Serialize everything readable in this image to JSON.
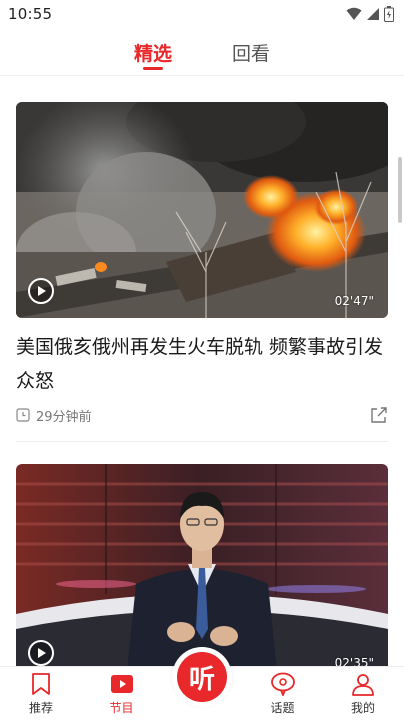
{
  "status_bar": {
    "time": "10:55"
  },
  "top_tabs": [
    {
      "label": "精选",
      "active": true
    },
    {
      "label": "回看",
      "active": false
    }
  ],
  "feed": [
    {
      "title": "美国俄亥俄州再发生火车脱轨 频繁事故引发众怒",
      "time_ago": "29分钟前",
      "duration": "02'47\"",
      "thumbnail": "train-derailment-fire-smoke"
    },
    {
      "duration": "02'35\"",
      "thumbnail": "news-anchor-studio"
    }
  ],
  "bottom_nav": {
    "items": [
      {
        "label": "推荐",
        "icon": "bookmark-icon",
        "active": false
      },
      {
        "label": "节目",
        "icon": "play-tv-icon",
        "active": true
      },
      {
        "label": "话题",
        "icon": "chat-bubble-icon",
        "active": false
      },
      {
        "label": "我的",
        "icon": "user-icon",
        "active": false
      }
    ],
    "center": {
      "label": "听"
    }
  },
  "colors": {
    "accent": "#e8282a",
    "text": "#1a1a1a",
    "meta": "#777777"
  }
}
